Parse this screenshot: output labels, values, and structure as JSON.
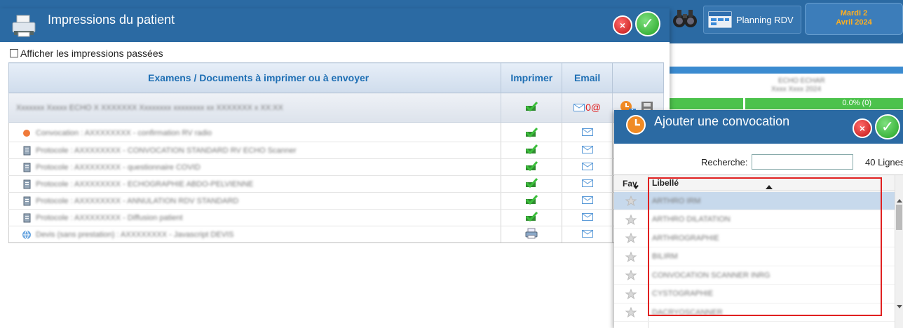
{
  "background": {
    "planning_label": "Planning RDV",
    "date_line1": "Mardi 2",
    "date_line2": "Avril 2024",
    "blur_text1": "ECHO ECHAR",
    "blur_text2": "Xxxx Xxxx 2024",
    "progress_text": "0.0% (0)",
    "progress_value": 0.0
  },
  "dialog": {
    "title": "Impressions du patient",
    "close_label": "×",
    "ok_label": "✓",
    "show_past_label": "Afficher les impressions passées",
    "show_past_checked": false,
    "columns": [
      "Examens / Documents à imprimer ou à envoyer",
      "Imprimer",
      "Email",
      ""
    ],
    "main_row": {
      "text": "Xxxxxxx Xxxxx ECHO X XXXXXXX Xxxxxxxx xxxxxxxx xx XXXXXXX x XX:XX",
      "email_count": "0@"
    },
    "documents": [
      {
        "icon": "orange-dot-icon",
        "text": "Convocation : AXXXXXXXX - confirmation RV radio",
        "print_icon": "printed-check-icon"
      },
      {
        "icon": "document-icon",
        "text": "Protocole : AXXXXXXXX - CONVOCATION STANDARD RV ECHO Scanner",
        "print_icon": "printed-check-icon"
      },
      {
        "icon": "document-icon",
        "text": "Protocole : AXXXXXXXX - questionnaire COVID",
        "print_icon": "printed-check-icon"
      },
      {
        "icon": "document-icon",
        "text": "Protocole : AXXXXXXXX - ECHOGRAPHIE ABDO-PELVIENNE",
        "print_icon": "printed-check-icon"
      },
      {
        "icon": "document-icon",
        "text": "Protocole : AXXXXXXXX - ANNULATION RDV STANDARD",
        "print_icon": "printed-check-icon"
      },
      {
        "icon": "document-icon",
        "text": "Protocole : AXXXXXXXX - Diffusion patient",
        "print_icon": "printed-check-icon"
      },
      {
        "icon": "globe-icon",
        "text": "Devis (sans prestation) : AXXXXXXXX - Javascript DEVIS",
        "print_icon": "printer-icon"
      }
    ]
  },
  "convocation": {
    "title": "Ajouter une convocation",
    "close_label": "×",
    "ok_label": "✓",
    "search_label": "Recherche:",
    "search_value": "",
    "lines_label": "40 Lignes",
    "col_fav": "Fav.",
    "col_label": "Libellé",
    "rows": [
      {
        "label": "ARTHRO IRM",
        "selected": true
      },
      {
        "label": "ARTHRO DILATATION",
        "selected": false
      },
      {
        "label": "ARTHROGRAPHIE",
        "selected": false
      },
      {
        "label": "BILIRM",
        "selected": false
      },
      {
        "label": "CONVOCATION SCANNER INRG",
        "selected": false
      },
      {
        "label": "CYSTOGRAPHIE",
        "selected": false
      },
      {
        "label": "DACRYOSCANNER",
        "selected": false
      }
    ]
  },
  "colors": {
    "header_blue": "#2b6aa3",
    "column_header_text": "#1e6fb4",
    "highlight_red": "#e02020",
    "progress_green": "#4cc24c",
    "date_orange": "#ffb020"
  }
}
